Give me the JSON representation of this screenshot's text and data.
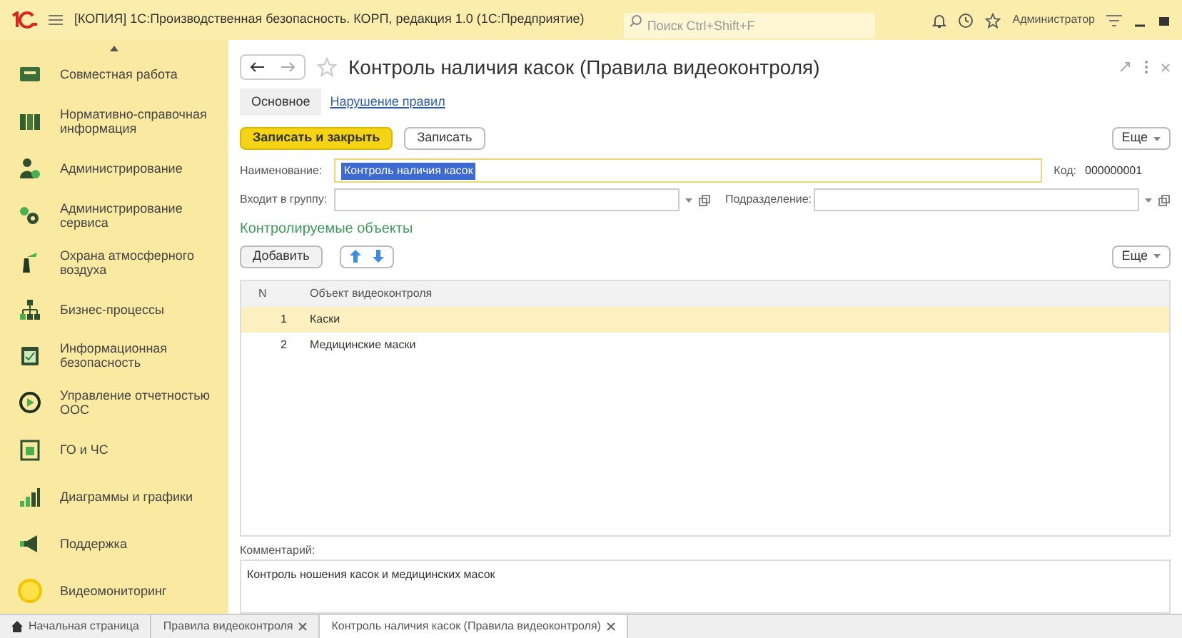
{
  "app_bar": {
    "title": "[КОПИЯ] 1С:Производственная безопасность. КОРП, редакция 1.0  (1С:Предприятие)",
    "search": {
      "placeholder": "Поиск Ctrl+Shift+F"
    },
    "user": "Администратор"
  },
  "sidebar": {
    "items": [
      {
        "label": "Совместная работа"
      },
      {
        "label": "Нормативно-справочная информация"
      },
      {
        "label": "Администрирование"
      },
      {
        "label": "Администрирование сервиса"
      },
      {
        "label": "Охрана атмосферного воздуха"
      },
      {
        "label": "Бизнес-процессы"
      },
      {
        "label": "Информационная безопасность"
      },
      {
        "label": "Управление отчетностью ООС"
      },
      {
        "label": "ГО и ЧС"
      },
      {
        "label": "Диаграммы и графики"
      },
      {
        "label": "Поддержка"
      },
      {
        "label": "Видеомониторинг"
      }
    ]
  },
  "form": {
    "title": "Контроль наличия касок (Правила видеоконтроля)",
    "tabs": [
      {
        "label": "Основное",
        "selected": true
      },
      {
        "label": "Нарушение правил",
        "selected": false
      }
    ],
    "buttons": {
      "primary": "Записать и закрыть",
      "secondary": "Записать",
      "more": "Еще"
    },
    "fields": {
      "name_label": "Наименование:",
      "name_value": "Контроль наличия касок",
      "code_label": "Код:",
      "code_value": "000000001",
      "group_label": "Входит в группу:",
      "division_label": "Подразделение:"
    },
    "section_title": "Контролируемые объекты",
    "table_toolbar": {
      "add": "Добавить",
      "more": "Еще"
    },
    "table": {
      "columns": [
        "N",
        "Объект видеоконтроля"
      ],
      "rows": [
        {
          "n": "1",
          "object": "Каски",
          "selected": true
        },
        {
          "n": "2",
          "object": "Медицинские маски",
          "selected": false
        }
      ]
    },
    "comment": {
      "label": "Комментарий:",
      "value": "Контроль ношения касок и медицинских масок"
    }
  },
  "bottom_tabs": [
    {
      "label": "Начальная страница",
      "kind": "home",
      "selected": false,
      "closable": false
    },
    {
      "label": "Правила видеоконтроля",
      "kind": "page",
      "selected": false,
      "closable": true
    },
    {
      "label": "Контроль наличия касок (Правила видеоконтроля)",
      "kind": "page",
      "selected": true,
      "closable": true
    }
  ]
}
